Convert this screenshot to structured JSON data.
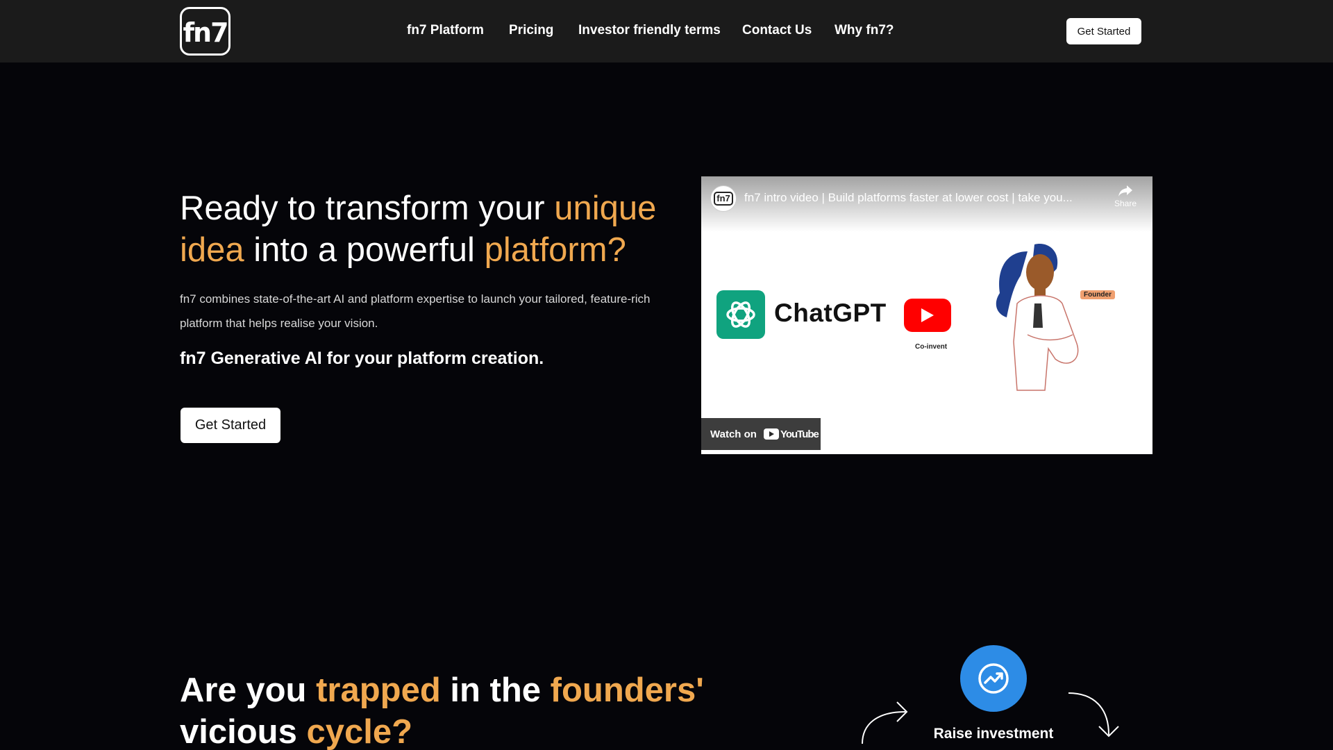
{
  "header": {
    "logo_text": "fn7",
    "nav": [
      {
        "label": "fn7 Platform"
      },
      {
        "label": "Pricing"
      },
      {
        "label": "Investor friendly terms"
      },
      {
        "label": "Contact Us"
      },
      {
        "label": "Why fn7?"
      }
    ],
    "cta_label": "Get Started"
  },
  "hero": {
    "title_parts": [
      "Ready to transform your ",
      "unique idea",
      " into a powerful ",
      "platform?"
    ],
    "description": "fn7 combines state-of-the-art AI and platform expertise to launch your tailored, feature-rich platform that helps realise your vision.",
    "subheading": "fn7 Generative AI for your platform creation.",
    "cta_label": "Get Started"
  },
  "video": {
    "channel_avatar_text": "fn7",
    "title": "fn7 intro video | Build platforms faster at lower cost | take you...",
    "share_label": "Share",
    "chatgpt_label": "ChatGPT",
    "coinvent_label": "Co-invent",
    "founder_label": "Founder",
    "watch_on_label": "Watch on",
    "youtube_label": "YouTube"
  },
  "cycle": {
    "title_parts": [
      "Are you ",
      "trapped",
      " in the ",
      "founders'",
      " vicious ",
      "cycle?"
    ],
    "raise_label": "Raise investment"
  },
  "colors": {
    "accent": "#f0a84f",
    "background": "#050509",
    "header_bg": "#1b1b1b",
    "raise_circle": "#2d8ce6",
    "chatgpt_green": "#10a37f",
    "youtube_red": "#ff0000"
  },
  "icons": {
    "logo": "fn7-logo",
    "share": "share-arrow-icon",
    "chatgpt": "openai-knot-icon",
    "youtube": "youtube-play-icon",
    "raise": "trending-up-circle-icon",
    "arrows": "curved-arrow-icon"
  }
}
